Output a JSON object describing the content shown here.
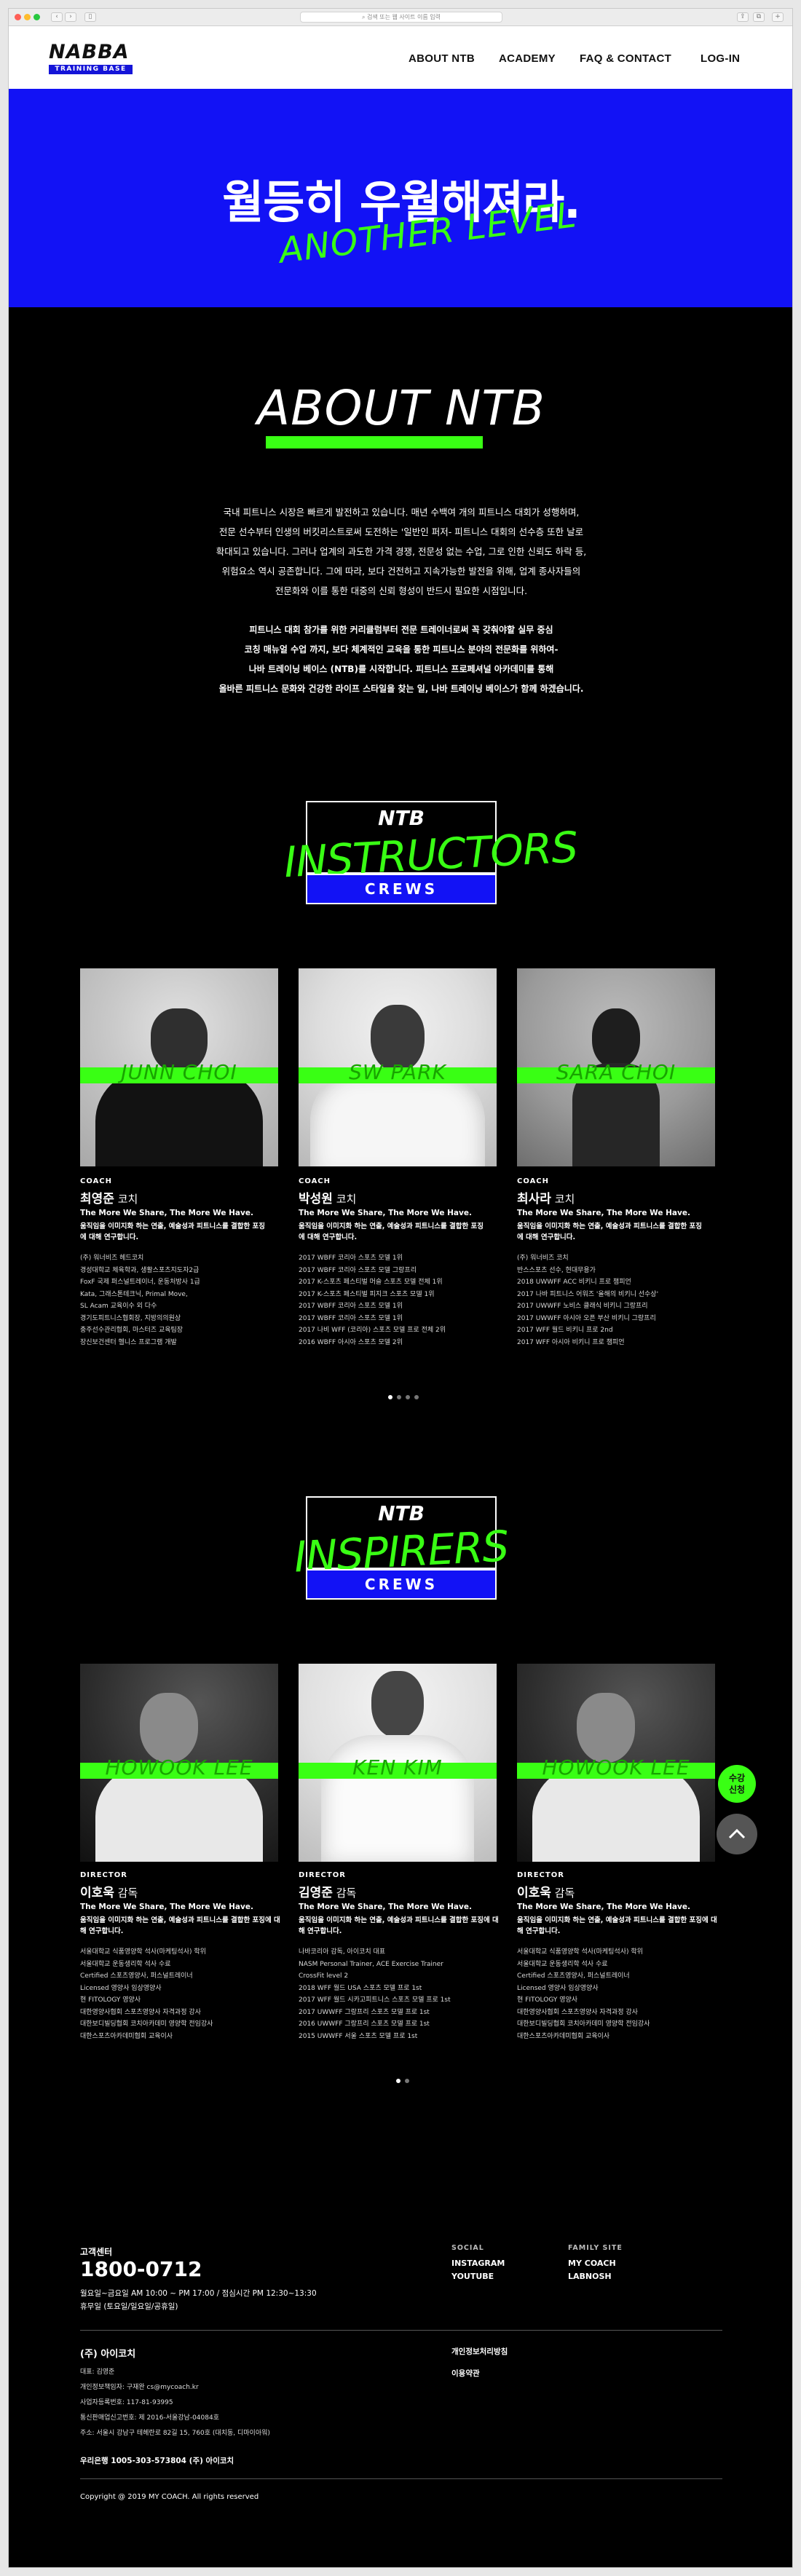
{
  "browser": {
    "url": "검색 또는 웹 사이트 이름 입력"
  },
  "header": {
    "logo_main": "NABBA",
    "logo_sub": "TRAINING BASE",
    "nav": [
      "ABOUT NTB",
      "ACADEMY",
      "FAQ & CONTACT",
      "LOG-IN"
    ]
  },
  "hero": {
    "headline": "월등히 우월해져라.",
    "tagline": "ANOTHER LEVEL"
  },
  "about": {
    "title": "ABOUT NTB",
    "para1": [
      "국내 피트니스 시장은 빠르게 발전하고 있습니다. 매년 수백여 개의 피트니스 대회가 성행하며,",
      "전문 선수부터 인생의 버킷리스트로써 도전하는 '일반인 퍼저- 피트니스 대회의 선수층 또한 날로",
      "확대되고 있습니다. 그러나 업계의 과도한 가격 경쟁, 전문성 없는 수업, 그로 인한 신뢰도 하락 등,",
      "위험요소 역시 공존합니다. 그에 따라, 보다 건전하고 지속가능한 발전을 위해, 업계 종사자들의",
      "전문화와 이를 통한 대중의 신뢰 형성이 반드시 필요한 시점입니다."
    ],
    "para2": [
      "피트니스 대회 참가를 위한 커리큘럼부터 전문 트레이너로써 꼭 갖춰야할 실무 중심",
      "코칭 매뉴얼 수업 까지, 보다 체계적인 교육을 통한 피트니스 분야의 전문화를 위하여-",
      "나바 트레이닝 베이스 (NTB)를 시작합니다. 피트니스 프로페셔널 아카데미를 통해",
      "올바른 피트니스 문화와 건강한 라이프 스타일을 찾는 일, 나바 트레이닝 베이스가 함께 하겠습니다."
    ]
  },
  "instructors": {
    "badge": {
      "top": "NTB",
      "word": "INSTRUCTORS",
      "bottom": "CREWS"
    },
    "cards": [
      {
        "photo_name": "JUNN CHOI",
        "role": "COACH",
        "name": "최영준",
        "title": " 코치",
        "motto": "The More We Share, The More We Have.",
        "desc": "움직임을 이미지화 하는 연출, 예술성과 피트니스를 결합한 포징에 대해 연구합니다.",
        "creds": [
          "(주) 워너비즈 헤드코치",
          "경성대학교 체육학과, 생활스포츠지도자2급",
          "FoxF 국제 퍼스널트레이너, 운동처방사 1급",
          "Kata, 그래스톤테크닉, Primal Move,",
          "SL Acam 교육이수 외 다수",
          "경기도피트니스협회장, 지방의의원상",
          "충주선수관리협회, 마스터즈 교육팀장",
          "장신보건센터 헬니스 프로그램 개발"
        ]
      },
      {
        "photo_name": "SW PARK",
        "role": "COACH",
        "name": "박성원",
        "title": " 코치",
        "motto": "The More We Share, The More We Have.",
        "desc": "움직임을 이미지화 하는 연출, 예술성과 피트니스를 결합한 포징에 대해 연구합니다.",
        "creds": [
          "2017 WBFF 코리아 스포츠 모델 1위",
          "2017 WBFF 코리아 스포츠 모델 그랑프리",
          "2017 K-스포츠 페스티벌 머슬 스포츠 모델 전체 1위",
          "2017 K-스포츠 페스티벌 피지크 스포츠 모델 1위",
          "2017 WBFF 코리아 스포츠 모델 1위",
          "2017 WBFF 코리아 스포츠 모델 1위",
          "2017 나비 WFF (코리아) 스포츠 모델 프로 전체 2위",
          "2016 WBFF 아시아 스포츠 모델 2위"
        ]
      },
      {
        "photo_name": "SARA CHOI",
        "role": "COACH",
        "name": "최사라",
        "title": " 코치",
        "motto": "The More We Share, The More We Have.",
        "desc": "움직임을 이미지화 하는 연출, 예술성과 피트니스를 결합한 포징에 대해 연구합니다.",
        "creds": [
          "(주) 워너비즈 코치",
          "반스스포츠 선수, 현대무용가",
          "2018 UWWFF ACC 비키니 프로 챔피언",
          "2017 나바 피트니스 어워즈 '올해의 비키니 선수상'",
          "2017 UWWFF 노비스 클래식 비키니 그랑프리",
          "2017 UWWFF 아시아 오픈 부산 비키니 그랑프리",
          "2017 WFF 월드 비키니 프로 2nd",
          "2017 WFF 아시아 비키니 프로 챔피언"
        ]
      }
    ]
  },
  "inspirers": {
    "badge": {
      "top": "NTB",
      "word": "INSPIRERS",
      "bottom": "CREWS"
    },
    "cards": [
      {
        "photo_name": "HOWOOK LEE",
        "role": "DIRECTOR",
        "name": "이호욱",
        "title": " 감독",
        "motto": "The More We Share, The More We Have.",
        "desc": "움직임을 이미지화 하는 연출, 예술성과 피트니스를 결합한 포징에 대해 연구합니다.",
        "creds": [
          "서울대학교 식품영양학 석사(마케팅석사) 학위",
          "서울대학교 운동생리학 석사 수료",
          "Certified 스포츠영양사, 퍼스널트레이너",
          "Licensed 영양사 임상영양사",
          "현 FITOLOGY 영양사",
          "대한영양사협회 스포츠영양사 자격과정 강사",
          "대한보디빌딩협회 코치아카데미 영양학 전임강사",
          "대한스포츠아카데미협회 교육이사"
        ]
      },
      {
        "photo_name": "KEN KIM",
        "role": "DIRECTOR",
        "name": "김영준",
        "title": " 감독",
        "motto": "The More We Share, The More We Have.",
        "desc": "움직임을 이미지화 하는 연출, 예술성과 피트니스를 결합한 포징에 대해 연구합니다.",
        "creds": [
          "나바코리아 감독, 아이코치 대표",
          "NASM Personal Trainer, ACE Exercise Trainer",
          "CrossFit level 2",
          "2018 WFF 월드 USA 스포츠 모델 프로 1st",
          "2017 WFF 월드 시카고피트니스 스포츠 모델 프로 1st",
          "2017 UWWFF 그랑프리 스포츠 모델 프로 1st",
          "2016 UWWFF 그랑프리 스포츠 모델 프로 1st",
          "2015 UWWFF 서울 스포츠 모델 프로 1st"
        ]
      },
      {
        "photo_name": "HOWOOK LEE",
        "role": "DIRECTOR",
        "name": "이호욱",
        "title": " 감독",
        "motto": "The More We Share, The More We Have.",
        "desc": "움직임을 이미지화 하는 연출, 예술성과 피트니스를 결합한 포징에 대해 연구합니다.",
        "creds": [
          "서울대학교 식품영양학 석사(마케팅석사) 학위",
          "서울대학교 운동생리학 석사 수료",
          "Certified 스포츠영양사, 퍼스널트레이너",
          "Licensed 영양사 임상영양사",
          "현 FITOLOGY 영양사",
          "대한영양사협회 스포츠영양사 자격과정 강사",
          "대한보디빌딩협회 코치아카데미 영양학 전임강사",
          "대한스포츠아카데미협회 교육이사"
        ]
      }
    ]
  },
  "floating": {
    "apply": "수강\n신청",
    "top_icon": "chevron-up-icon"
  },
  "footer": {
    "cs_label": "고객센터",
    "phone": "1800-0712",
    "hours": "월요일~금요일 AM 10:00 ~ PM 17:00 / 점심시간 PM 12:30~13:30",
    "holiday": "휴무일 (토요일/일요일/공휴일)",
    "social_label": "SOCIAL",
    "social": [
      "INSTAGRAM",
      "YOUTUBE"
    ],
    "family_label": "FAMILY SITE",
    "family": [
      "MY COACH",
      "LABNOSH"
    ],
    "company": "(주) 아이코치",
    "info": [
      "대표: 김영준",
      "개인정보책임자: 구재완 cs@mycoach.kr",
      "사업자등록번호: 117-81-93995",
      "통신판매업신고번호: 제 2016-서울강남-04084호",
      "주소: 서울시 강남구 테헤란로 82길 15, 760호 (대치동, 디마이아워)"
    ],
    "bank": "우리은행 1005-303-573804 (주) 아이코치",
    "policies": [
      "개인정보처리방침",
      "이용약관"
    ],
    "copyright": "Copyright @ 2019 MY COACH. All rights reserved"
  },
  "colors": {
    "accent_green": "#39ff14",
    "brand_blue": "#1212f5",
    "bg": "#000000"
  }
}
